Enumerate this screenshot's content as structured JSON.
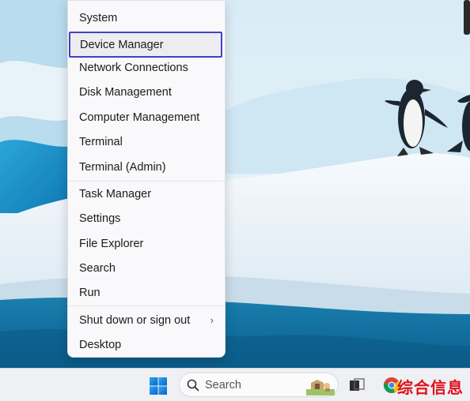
{
  "menu": {
    "items": [
      {
        "label": "System"
      },
      {
        "label": "Device Manager",
        "highlighted": true
      },
      {
        "label": "Network Connections"
      },
      {
        "label": "Disk Management"
      },
      {
        "label": "Computer Management"
      },
      {
        "label": "Terminal"
      },
      {
        "label": "Terminal (Admin)"
      },
      {
        "label": "Task Manager"
      },
      {
        "label": "Settings"
      },
      {
        "label": "File Explorer"
      },
      {
        "label": "Search"
      },
      {
        "label": "Run"
      },
      {
        "label": "Shut down or sign out",
        "has_submenu": true
      },
      {
        "label": "Desktop"
      }
    ],
    "highlight_color": "#3f42c8"
  },
  "taskbar": {
    "search_placeholder": "Search",
    "icons": [
      "windows-start-icon",
      "search-icon",
      "task-view-icon",
      "chrome-icon"
    ]
  },
  "watermark": {
    "text": "综合信息",
    "color": "#e0101a"
  },
  "wallpaper": {
    "subject": "penguins on iceberg"
  }
}
